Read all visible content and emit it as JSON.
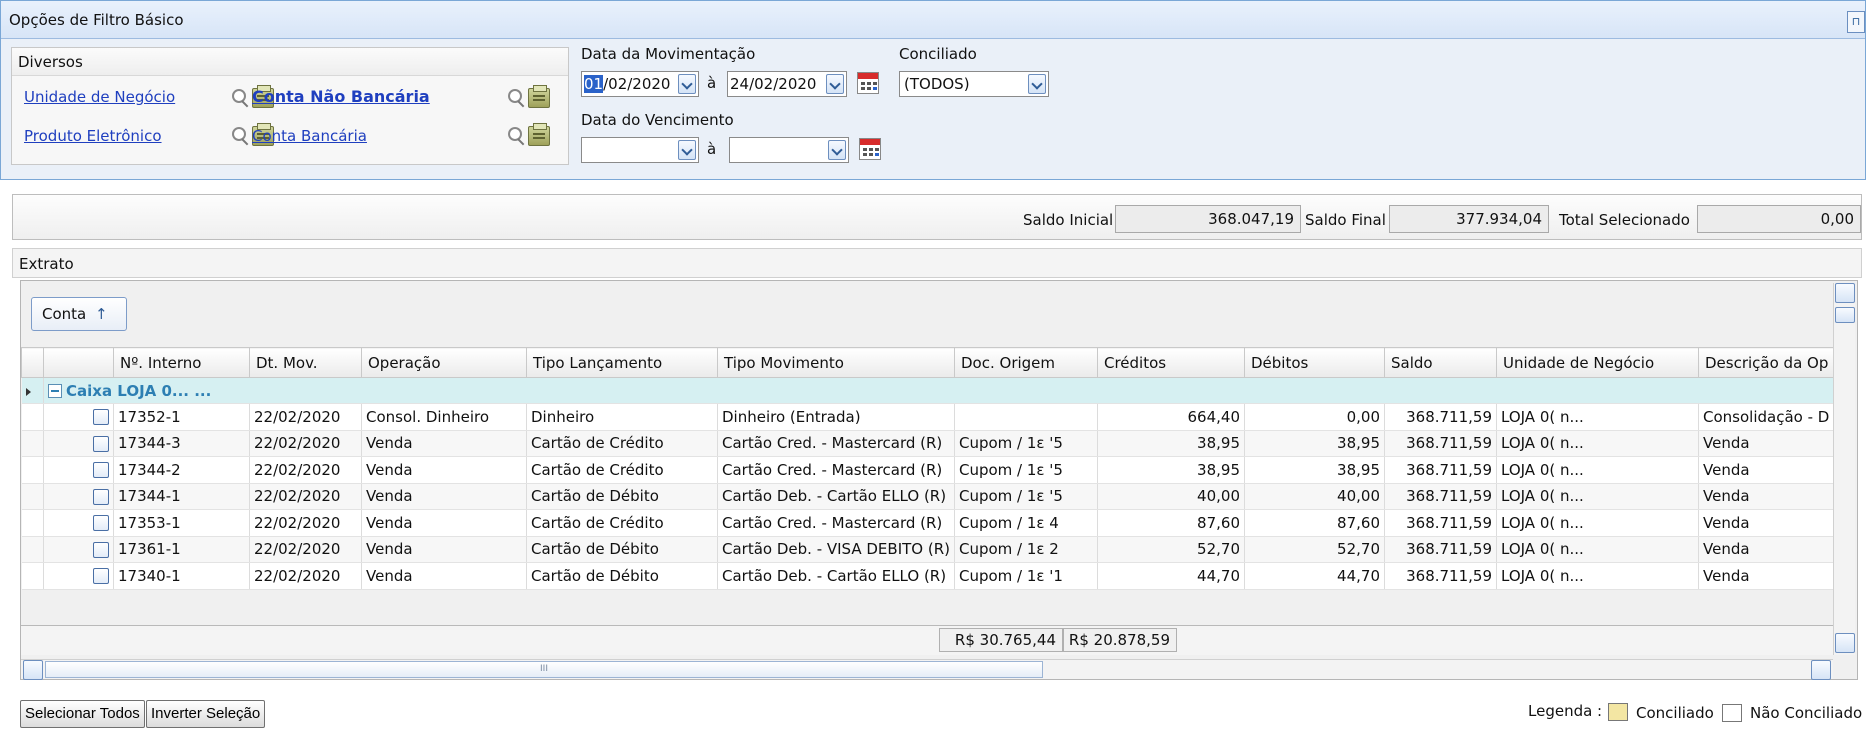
{
  "filter_panel": {
    "title": "Opções de Filtro Básico",
    "pin_icon": "pin-icon",
    "diversos": {
      "title": "Diversos",
      "unidade_negocio": "Unidade de Negócio",
      "conta_nao_bancaria": "Conta Não Bancária",
      "produto_eletronico": "Produto Eletrônico",
      "conta_bancaria": "Conta Bancária"
    },
    "data_movimentacao": {
      "label": "Data da Movimentação",
      "from_selected": "01",
      "from_rest": "/02/2020",
      "sep": "à",
      "to": "24/02/2020"
    },
    "data_vencimento": {
      "label": "Data do Vencimento",
      "from": "",
      "sep": "à",
      "to": ""
    },
    "conciliado": {
      "label": "Conciliado",
      "value": "(TODOS)"
    }
  },
  "saldo": {
    "inicial_label": "Saldo Inicial",
    "inicial_value": "368.047,19",
    "final_label": "Saldo Final",
    "final_value": "377.934,04",
    "total_label": "Total Selecionado",
    "total_value": "0,00"
  },
  "extrato": {
    "title": "Extrato",
    "group_button": "Conta",
    "group_arrow": "↑",
    "columns": [
      "Nº. Interno",
      "Dt. Mov.",
      "Operação",
      "Tipo Lançamento",
      "Tipo Movimento",
      "Doc. Origem",
      "Créditos",
      "Débitos",
      "Saldo",
      "Unidade de Negócio",
      "Descrição da Op"
    ],
    "group_label": "Caixa LOJA 0... ...",
    "rows": [
      {
        "interno": "17352-1",
        "dt": "22/02/2020",
        "operacao": "Consol. Dinheiro",
        "tipo_lanc": "Dinheiro",
        "tipo_mov": "Dinheiro (Entrada)",
        "doc": "",
        "creditos": "664,40",
        "debitos": "0,00",
        "saldo": "368.711,59",
        "unidade": "LOJA 0(   ⁠n...",
        "descricao": "Consolidação - D"
      },
      {
        "interno": "17344-3",
        "dt": "22/02/2020",
        "operacao": "Venda",
        "tipo_lanc": "Cartão de Crédito",
        "tipo_mov": "Cartão Cred. - Mastercard (R)",
        "doc": "Cupom / 1ε  '5",
        "creditos": "38,95",
        "debitos": "38,95",
        "saldo": "368.711,59",
        "unidade": "LOJA 0(   ⁠n...",
        "descricao": "Venda"
      },
      {
        "interno": "17344-2",
        "dt": "22/02/2020",
        "operacao": "Venda",
        "tipo_lanc": "Cartão de Crédito",
        "tipo_mov": "Cartão Cred. - Mastercard (R)",
        "doc": "Cupom / 1ε  '5",
        "creditos": "38,95",
        "debitos": "38,95",
        "saldo": "368.711,59",
        "unidade": "LOJA 0(   ⁠n...",
        "descricao": "Venda"
      },
      {
        "interno": "17344-1",
        "dt": "22/02/2020",
        "operacao": "Venda",
        "tipo_lanc": "Cartão de Débito",
        "tipo_mov": "Cartão Deb. - Cartão ELLO (R)",
        "doc": "Cupom / 1ε  '5",
        "creditos": "40,00",
        "debitos": "40,00",
        "saldo": "368.711,59",
        "unidade": "LOJA 0(   ⁠n...",
        "descricao": "Venda"
      },
      {
        "interno": "17353-1",
        "dt": "22/02/2020",
        "operacao": "Venda",
        "tipo_lanc": "Cartão de Crédito",
        "tipo_mov": "Cartão Cred. - Mastercard (R)",
        "doc": "Cupom / 1ε  ⁠4",
        "creditos": "87,60",
        "debitos": "87,60",
        "saldo": "368.711,59",
        "unidade": "LOJA 0(   ⁠n...",
        "descricao": "Venda"
      },
      {
        "interno": "17361-1",
        "dt": "22/02/2020",
        "operacao": "Venda",
        "tipo_lanc": "Cartão de Débito",
        "tipo_mov": "Cartão Deb. - VISA DEBITO (R)",
        "doc": "Cupom / 1ε  ⁠2",
        "creditos": "52,70",
        "debitos": "52,70",
        "saldo": "368.711,59",
        "unidade": "LOJA 0(   ⁠n...",
        "descricao": "Venda"
      },
      {
        "interno": "17340-1",
        "dt": "22/02/2020",
        "operacao": "Venda",
        "tipo_lanc": "Cartão de Débito",
        "tipo_mov": "Cartão Deb. - Cartão ELLO (R)",
        "doc": "Cupom / 1ε  '1",
        "creditos": "44,70",
        "debitos": "44,70",
        "saldo": "368.711,59",
        "unidade": "LOJA 0(   ⁠n...",
        "descricao": "Venda"
      }
    ],
    "total_creditos": "R$ 30.765,44",
    "total_debitos": "R$ 20.878,59",
    "hscroll_grip": "III"
  },
  "actions": {
    "selecionar_todos": "Selecionar Todos",
    "inverter_selecao": "Inverter Seleção"
  },
  "legend": {
    "label": "Legenda :",
    "conciliado": "Conciliado",
    "nao_conciliado": "Não Conciliado",
    "conciliado_color": "#f3e6a3",
    "nao_conciliado_color": "#ffffff"
  }
}
